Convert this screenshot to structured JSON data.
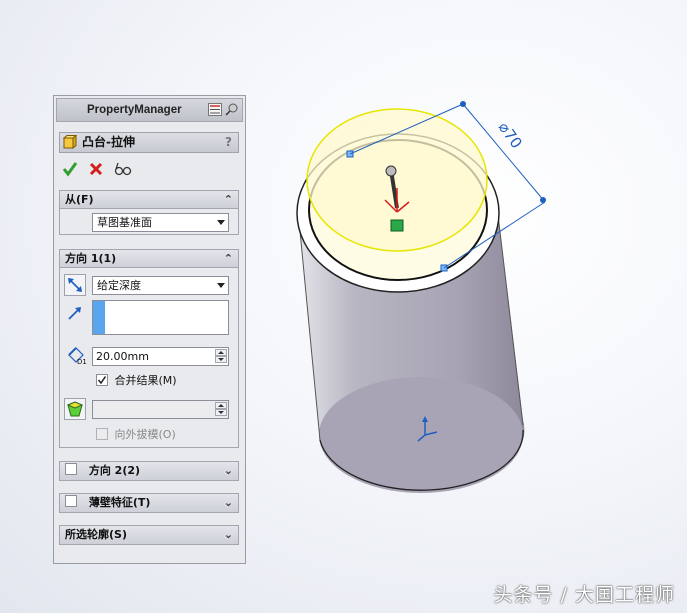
{
  "panel": {
    "title": "PropertyManager",
    "feature_name": "凸台-拉伸",
    "help_label": "?",
    "from": {
      "header": "从(F)",
      "start_condition": "草图基准面"
    },
    "direction1": {
      "header": "方向 1(1)",
      "end_condition": "给定深度",
      "direction_value": "",
      "depth": "20.00mm",
      "merge_label": "合并结果(M)",
      "merge_checked": true,
      "draft_value": "",
      "draft_outward_label": "向外拔模(O)"
    },
    "direction2": {
      "header": "方向 2(2)"
    },
    "thin_feature": {
      "header": "薄壁特征(T)"
    },
    "selected_contours": {
      "header": "所选轮廓(S)"
    }
  },
  "viewport": {
    "dimension_label": "⌀70"
  },
  "watermark": "头条号 / 大国工程师",
  "colors": {
    "panel_bg": "#e9eaee",
    "cylinder_body": "#aeaab8",
    "preview_yellow": "#fffacd",
    "preview_outline": "#e6e600",
    "dimension_blue": "#1f5fbf",
    "ok_green": "#2ea02e",
    "cancel_red": "#d21e1e"
  }
}
